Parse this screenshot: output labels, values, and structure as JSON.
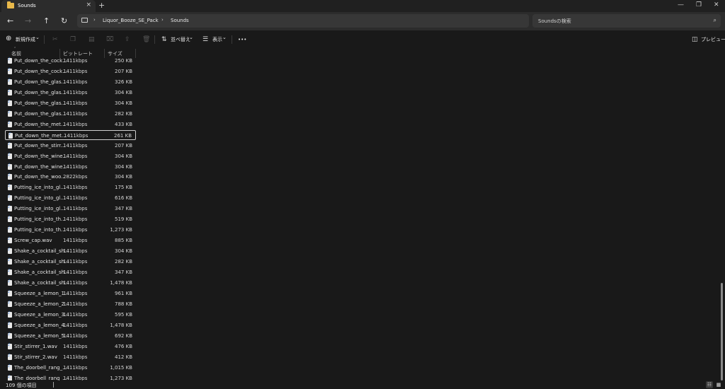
{
  "window": {
    "tab_title": "Sounds",
    "tab_close": "×",
    "new_tab": "+",
    "minimize": "—",
    "maximize": "❐",
    "close": "✕"
  },
  "nav": {
    "back_icon": "←",
    "forward_icon": "→",
    "up_icon": "↑",
    "refresh_icon": "↻",
    "breadcrumbs": [
      "Liquor_Booze_SE_Pack",
      "Sounds"
    ],
    "crumb_sep": "›",
    "search_placeholder": "Soundsの検索"
  },
  "toolbar": {
    "new_label": "新規作成",
    "sort_label": "並べ替え",
    "view_label": "表示",
    "more": "•••",
    "preview_label": "プレビュー",
    "dropdown": "⌄"
  },
  "columns": {
    "name": "名前",
    "bitrate": "ビットレート",
    "size": "サイズ"
  },
  "files": [
    {
      "name": "Put_down_the_cock...",
      "bitrate": "1411kbps",
      "size": "250 KB"
    },
    {
      "name": "Put_down_the_cock...",
      "bitrate": "1411kbps",
      "size": "207 KB"
    },
    {
      "name": "Put_down_the_glas...",
      "bitrate": "1411kbps",
      "size": "326 KB"
    },
    {
      "name": "Put_down_the_glas...",
      "bitrate": "1411kbps",
      "size": "304 KB"
    },
    {
      "name": "Put_down_the_glas...",
      "bitrate": "1411kbps",
      "size": "304 KB"
    },
    {
      "name": "Put_down_the_glas...",
      "bitrate": "1411kbps",
      "size": "282 KB"
    },
    {
      "name": "Put_down_the_met...",
      "bitrate": "1411kbps",
      "size": "433 KB"
    },
    {
      "name": "Put_down_the_met...",
      "bitrate": "1411kbps",
      "size": "261 KB",
      "selected": true
    },
    {
      "name": "Put_down_the_stirr...",
      "bitrate": "1411kbps",
      "size": "207 KB"
    },
    {
      "name": "Put_down_the_wine...",
      "bitrate": "1411kbps",
      "size": "304 KB"
    },
    {
      "name": "Put_down_the_wine...",
      "bitrate": "1411kbps",
      "size": "304 KB"
    },
    {
      "name": "Put_down_the_woo...",
      "bitrate": "2822kbps",
      "size": "304 KB"
    },
    {
      "name": "Putting_ice_into_gl...",
      "bitrate": "1411kbps",
      "size": "175 KB"
    },
    {
      "name": "Putting_ice_into_gl...",
      "bitrate": "1411kbps",
      "size": "616 KB"
    },
    {
      "name": "Putting_ice_into_gl...",
      "bitrate": "1411kbps",
      "size": "347 KB"
    },
    {
      "name": "Putting_ice_into_th...",
      "bitrate": "1411kbps",
      "size": "519 KB"
    },
    {
      "name": "Putting_ice_into_th...",
      "bitrate": "1411kbps",
      "size": "1,273 KB"
    },
    {
      "name": "Screw_cap.wav",
      "bitrate": "1411kbps",
      "size": "885 KB"
    },
    {
      "name": "Shake_a_cocktail_sh...",
      "bitrate": "1411kbps",
      "size": "304 KB"
    },
    {
      "name": "Shake_a_cocktail_sh...",
      "bitrate": "1411kbps",
      "size": "282 KB"
    },
    {
      "name": "Shake_a_cocktail_sh...",
      "bitrate": "1411kbps",
      "size": "347 KB"
    },
    {
      "name": "Shake_a_cocktail_sh...",
      "bitrate": "1411kbps",
      "size": "1,478 KB"
    },
    {
      "name": "Squeeze_a_lemon_1...",
      "bitrate": "1411kbps",
      "size": "961 KB"
    },
    {
      "name": "Squeeze_a_lemon_2...",
      "bitrate": "1411kbps",
      "size": "788 KB"
    },
    {
      "name": "Squeeze_a_lemon_3...",
      "bitrate": "1411kbps",
      "size": "595 KB"
    },
    {
      "name": "Squeeze_a_lemon_4...",
      "bitrate": "1411kbps",
      "size": "1,478 KB"
    },
    {
      "name": "Squeeze_a_lemon_5...",
      "bitrate": "1411kbps",
      "size": "692 KB"
    },
    {
      "name": "Stir_stirrer_1.wav",
      "bitrate": "1411kbps",
      "size": "476 KB"
    },
    {
      "name": "Stir_stirrer_2.wav",
      "bitrate": "1411kbps",
      "size": "412 KB"
    },
    {
      "name": "The_doorbell_rang_...",
      "bitrate": "1411kbps",
      "size": "1,015 KB"
    },
    {
      "name": "The_doorbell_rang_...",
      "bitrate": "1411kbps",
      "size": "1,273 KB"
    }
  ],
  "status": {
    "item_count": "109 個の項目",
    "separator": "|"
  }
}
